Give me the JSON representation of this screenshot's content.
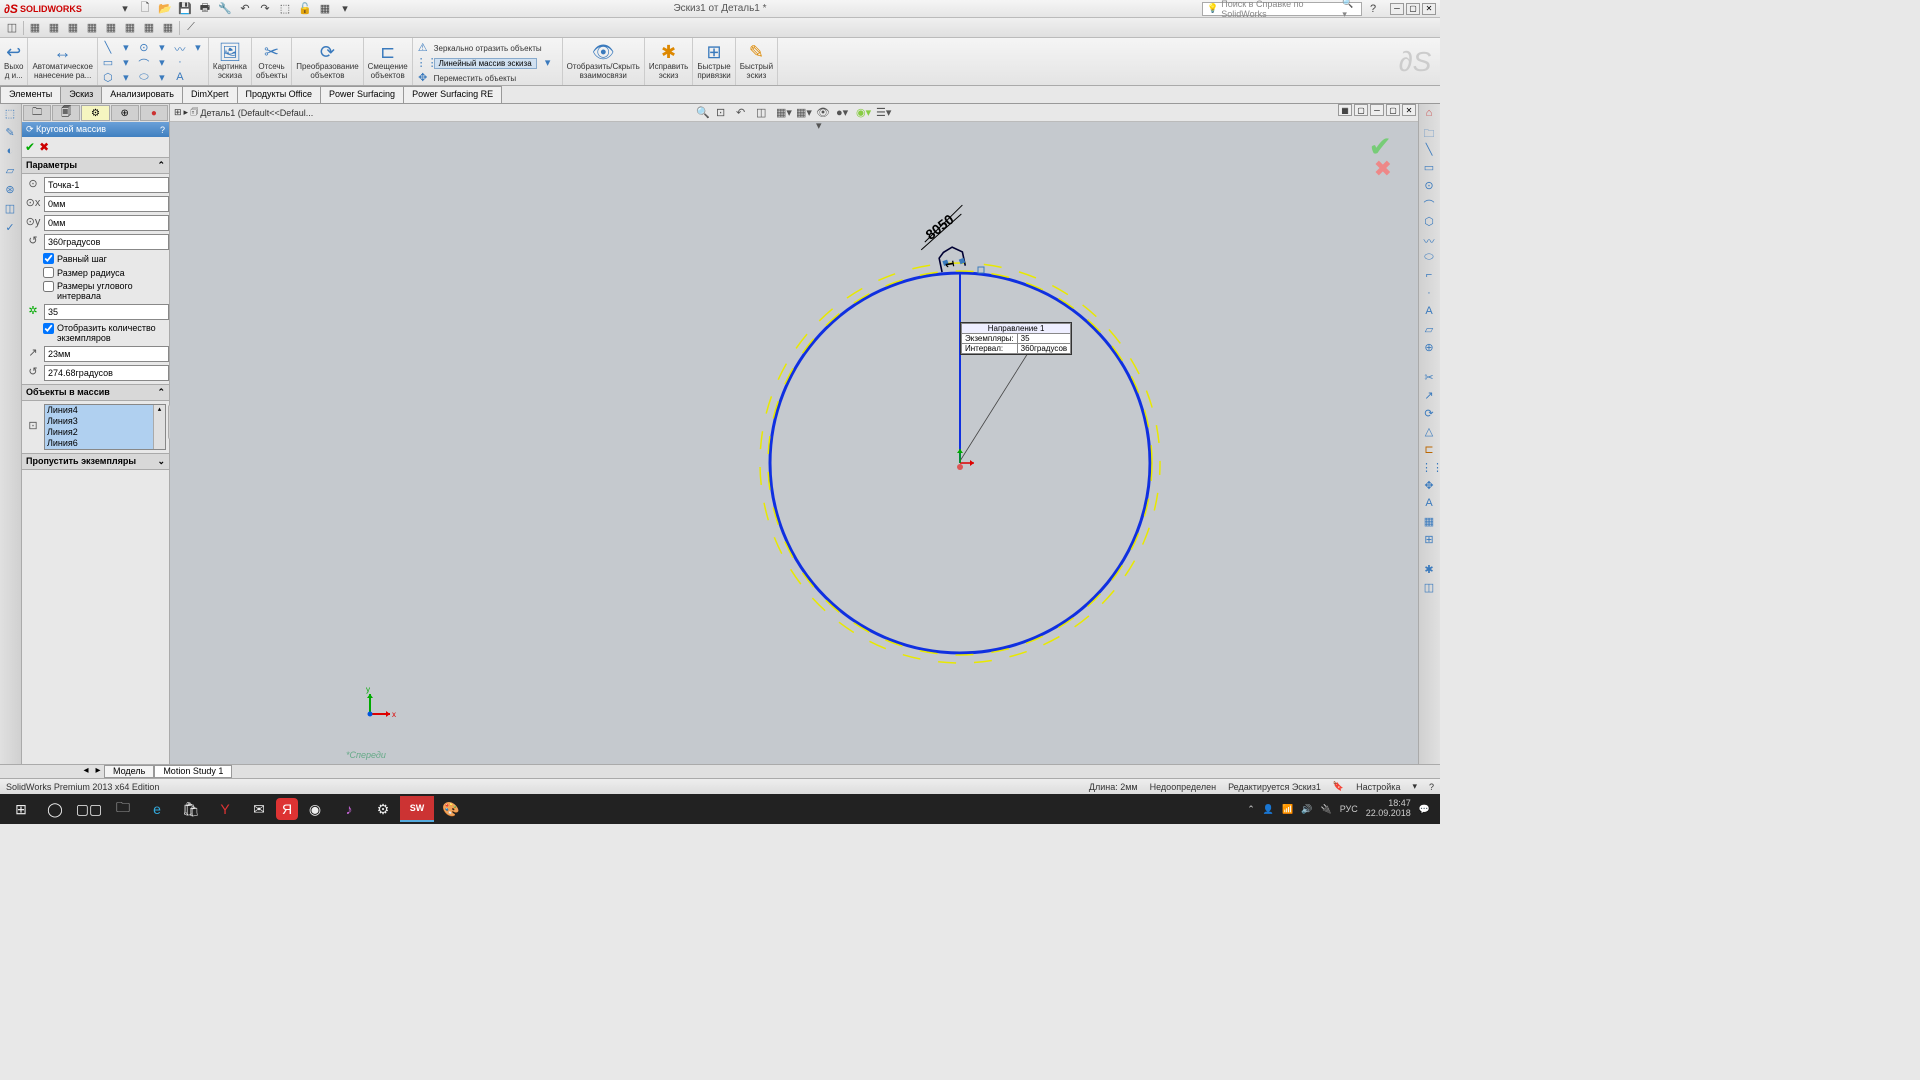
{
  "title": {
    "app": "SOLIDWORKS",
    "doc": "Эскиз1 от Деталь1 *",
    "search_ph": "Поиск в Справке по SolidWorks"
  },
  "qat_icons": [
    "new",
    "open",
    "save",
    "print",
    "rebuild",
    "undo",
    "redo",
    "select",
    "options",
    "macro",
    "dropdown"
  ],
  "ribbon": {
    "g1": "Выхо\nд и...",
    "g2": "Автоматическое\nнанесение ра...",
    "g3": "Картинка\nэскиза",
    "g4": "Отсечь\nобъекты",
    "g5": "Преобразование\nобъектов",
    "g6": "Смещение\nобъектов",
    "mirror": "Зеркально отразить объекты",
    "linear": "Линейный массив эскиза",
    "move": "Переместить объекты",
    "g7": "Отобразить/Скрыть\nвзаимосвязи",
    "g8": "Исправить\nэскиз",
    "g9": "Быстрые\nпривязки",
    "g10": "Быстрый\nэскиз"
  },
  "tabs": [
    "Элементы",
    "Эскиз",
    "Анализировать",
    "DimXpert",
    "Продукты Office",
    "Power Surfacing",
    "Power Surfacing RE"
  ],
  "tree": {
    "crumb": "Деталь1  (Default<<Defaul..."
  },
  "panel": {
    "title": "Круговой массив",
    "sec1": "Параметры",
    "point": "Точка-1",
    "x": "0мм",
    "y": "0мм",
    "angle": "360градусов",
    "eq": "Равный шаг",
    "rad": "Размер радиуса",
    "ang_int": "Размеры углового интервала",
    "count": "35",
    "show": "Отобразить количество\nэкземпляров",
    "dist": "23мм",
    "rot": "274.68градусов",
    "sec2": "Объекты в массив",
    "items": [
      "Линия4",
      "Линия3",
      "Линия2",
      "Линия6"
    ],
    "sec3": "Пропустить экземпляры"
  },
  "callout": {
    "hdr": "Направление 1",
    "r1a": "Экземпляры:",
    "r1b": "35",
    "r2a": "Интервал:",
    "r2b": "360градусов"
  },
  "viewlbl": "*Спереди",
  "btm_tabs": [
    "Модель",
    "Motion Study 1"
  ],
  "status": {
    "left": "SolidWorks Premium 2013 x64 Edition",
    "len": "Длина: 2мм",
    "def": "Недоопределен",
    "edit": "Редактируется Эскиз1",
    "cust": "Настройка"
  },
  "tray": {
    "lang": "РУС",
    "time": "18:47",
    "date": "22.09.2018"
  },
  "dim": "8050"
}
